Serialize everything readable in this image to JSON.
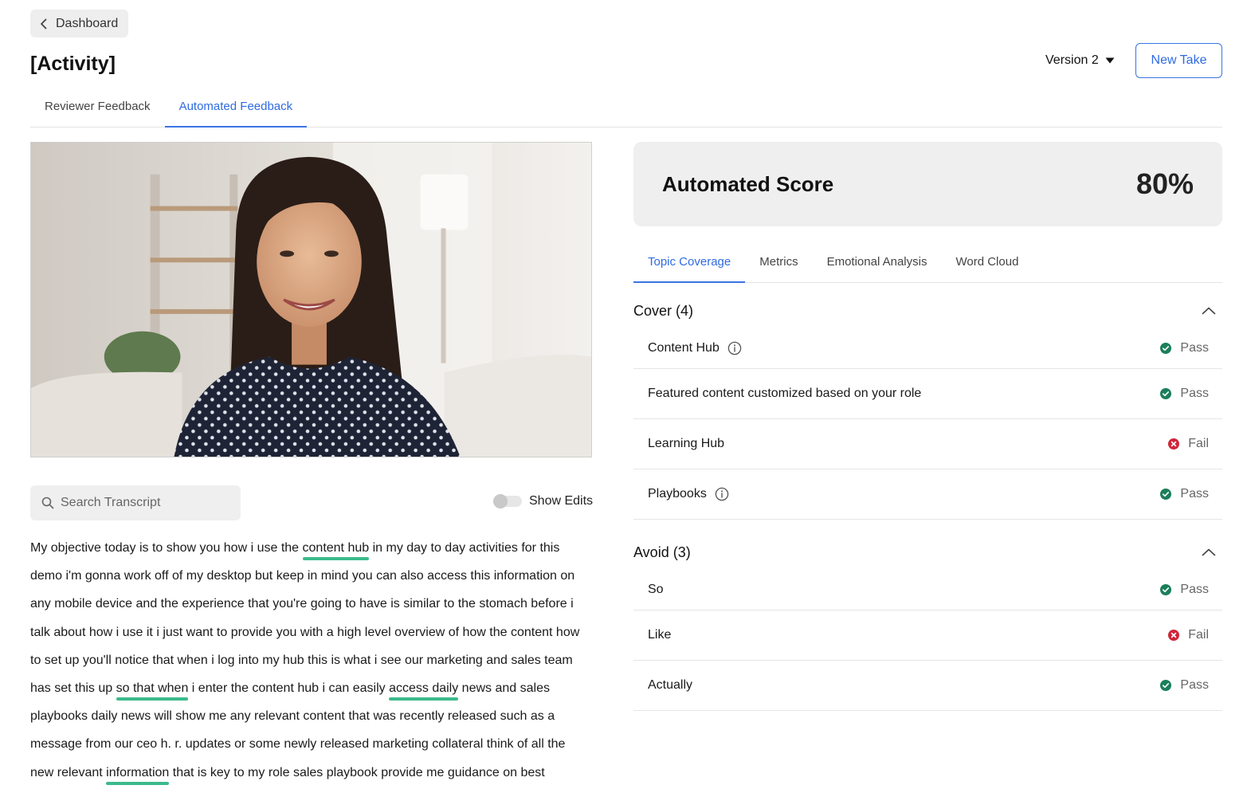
{
  "nav": {
    "back_label": "Dashboard"
  },
  "page": {
    "title": "[Activity]"
  },
  "header": {
    "version_label": "Version 2",
    "new_take_label": "New Take"
  },
  "main_tabs": [
    {
      "label": "Reviewer Feedback",
      "active": false
    },
    {
      "label": "Automated Feedback",
      "active": true
    }
  ],
  "transcript_controls": {
    "search_placeholder": "Search Transcript",
    "show_edits_label": "Show Edits",
    "show_edits_on": false
  },
  "transcript": [
    {
      "text": "My objective today is to show you how i use the ",
      "highlight": false
    },
    {
      "text": "content hub",
      "highlight": true
    },
    {
      "text": " in my day to day activities for this demo i'm gonna work off of my desktop but keep in mind you can also access this information on any mobile device and the experience that you're going to have is similar to the stomach before i talk about how i use it i just want to provide you with a high level overview of how the content how to set up you'll notice that when i log into my hub this is what i see our marketing and sales team has set this up ",
      "highlight": false
    },
    {
      "text": "so that when",
      "highlight": true
    },
    {
      "text": " i enter the content hub i can easily ",
      "highlight": false
    },
    {
      "text": "access daily",
      "highlight": true
    },
    {
      "text": " news and sales playbooks daily news will show me any relevant content that was recently released such as a message from our ceo h. r. updates or some newly released marketing collateral think of all the new relevant ",
      "highlight": false
    },
    {
      "text": "information",
      "highlight": true
    },
    {
      "text": " that is key to my role sales playbook provide me guidance on best",
      "highlight": false
    }
  ],
  "score": {
    "label": "Automated Score",
    "value": "80%"
  },
  "sub_tabs": [
    {
      "label": "Topic Coverage",
      "active": true
    },
    {
      "label": "Metrics",
      "active": false
    },
    {
      "label": "Emotional Analysis",
      "active": false
    },
    {
      "label": "Word Cloud",
      "active": false
    }
  ],
  "sections": [
    {
      "title": "Cover (4)",
      "items": [
        {
          "label": "Content Hub",
          "info": true,
          "status": "Pass"
        },
        {
          "label": "Featured content customized based on your role",
          "info": false,
          "status": "Pass"
        },
        {
          "label": "Learning Hub",
          "info": false,
          "status": "Fail"
        },
        {
          "label": "Playbooks",
          "info": true,
          "status": "Pass"
        }
      ]
    },
    {
      "title": "Avoid (3)",
      "items": [
        {
          "label": "So",
          "info": false,
          "status": "Pass"
        },
        {
          "label": "Like",
          "info": false,
          "status": "Fail"
        },
        {
          "label": "Actually",
          "info": false,
          "status": "Pass"
        }
      ]
    }
  ],
  "colors": {
    "accent": "#3b74e4",
    "pass": "#1a7f5a",
    "fail": "#d0253a",
    "highlight": "#3cba8c"
  },
  "icons": [
    "chevron-left-icon",
    "caret-down-icon",
    "search-icon",
    "info-icon",
    "chevron-up-icon",
    "check-circle-icon",
    "x-circle-icon"
  ]
}
